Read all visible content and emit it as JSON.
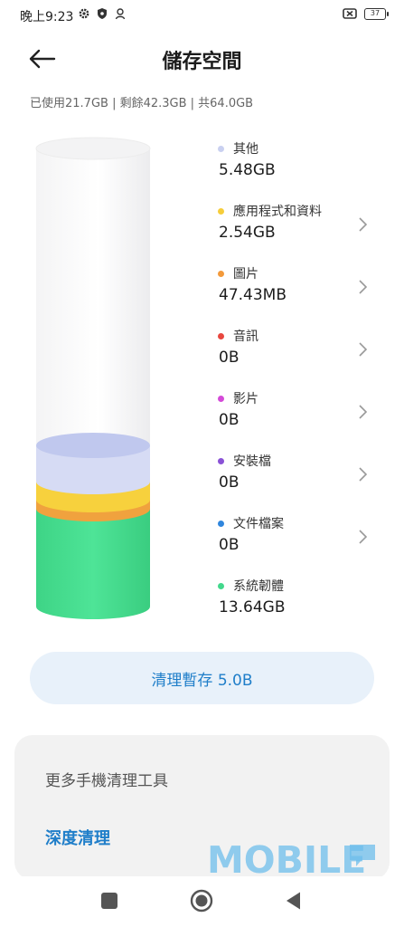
{
  "status_bar": {
    "time": "晚上9:23",
    "icons": [
      "gear-icon",
      "shield-icon",
      "person-icon"
    ],
    "right_icons": [
      "no-sim-icon",
      "battery-icon"
    ],
    "battery_level": "37"
  },
  "header": {
    "title": "儲存空間",
    "back_icon": "arrow-left-icon"
  },
  "summary": "已使用21.7GB | 剩餘42.3GB | 共64.0GB",
  "categories": [
    {
      "label": "其他",
      "value": "5.48GB",
      "color": "#c9d0f0",
      "chevron": false
    },
    {
      "label": "應用程式和資料",
      "value": "2.54GB",
      "color": "#f6cd3a",
      "chevron": true
    },
    {
      "label": "圖片",
      "value": "47.43MB",
      "color": "#f39a3b",
      "chevron": true
    },
    {
      "label": "音訊",
      "value": "0B",
      "color": "#e8473f",
      "chevron": true
    },
    {
      "label": "影片",
      "value": "0B",
      "color": "#d44ad8",
      "chevron": true
    },
    {
      "label": "安裝檔",
      "value": "0B",
      "color": "#8a52d6",
      "chevron": true
    },
    {
      "label": "文件檔案",
      "value": "0B",
      "color": "#2f86dd",
      "chevron": true
    },
    {
      "label": "系統韌體",
      "value": "13.64GB",
      "color": "#43d88c",
      "chevron": false
    }
  ],
  "clean_button": {
    "label": "清理暫存 5.0B"
  },
  "tools": {
    "title": "更多手機清理工具",
    "deep_clean": "深度清理"
  },
  "watermark": "MOBILE",
  "nav": [
    "recents-square-icon",
    "home-circle-icon",
    "back-triangle-icon"
  ]
}
